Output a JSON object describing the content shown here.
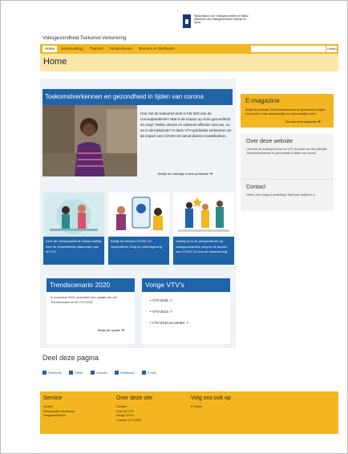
{
  "header": {
    "logo_text": "Rijksinstituut voor Volksgezondheid en Milieu Ministerie van Volksgezondheid, Welzijn en Sport",
    "site_name": "Volksgezondheid Toekomst Verkenning"
  },
  "nav": {
    "items": [
      "Home",
      "Samenvatting",
      "Thema's",
      "Perspectieven",
      "Bronnen en Methoden"
    ],
    "search_placeholder": "",
    "search_button": "Zoeken"
  },
  "page": {
    "title": "Home"
  },
  "hero": {
    "heading": "Toekomstverkennen en gezondheid in tijden van corona",
    "text": "Hoe ziet de toekomst eruit in het licht van de coronapandemie? Wat is de impact op onze gezondheid en zorg? Welke directe en indirecte effecten zien we, nu en in de toekomst? In deze VTV-publicatie verkennen we de impact van COVID-19 vanuit diverse invalshoeken.",
    "link": "Bekijk de volledige online publicatie"
  },
  "cards": [
    {
      "caption": "Lees de overkoepelende Samenvatting over de verschillende uitkomsten van de VTV"
    },
    {
      "caption": "Bekijk de thema's COVID-19, Gezondheid, Zorg en Leefomgeving"
    },
    {
      "caption": "Verdiep je in de perspectieven op volksgezondheid, zorg en de impact van COVID-19 voor de samenleving"
    }
  ],
  "trend": {
    "heading": "Trendscenario 2020",
    "text": "In november 2020 verscheen een update van het Trendscenario uit de VTV-2018.",
    "link": "Bekijk de update"
  },
  "vorige": {
    "heading": "Vorige VTV's",
    "items": [
      "VTV-2018",
      "VTV-2014",
      "VTV-2010 en eerder"
    ]
  },
  "emagazine": {
    "title": "E-magazine",
    "text": "Bekijk de publicatie 'Toekomstverkennen en gezondheid in tijden van corona' in een aantrekkelijke en overzichtelijke vorm.",
    "link": "Ga naar het e-magazine"
  },
  "about": {
    "title": "Over deze website",
    "text": "Lees hier de achtergrond van de VTV, de opzet van de publicatie Toekomstverkennen en gezondheid in tijden van corona."
  },
  "contact": {
    "title": "Contact",
    "text": "Heeft u een vraag of opmerking? Mail naar vtv@rivm.nl"
  },
  "share": {
    "title": "Deel deze pagina",
    "items": [
      "Facebook",
      "Twitter",
      "LinkedIn",
      "WhatsApp",
      "E-mail"
    ]
  },
  "footer": {
    "service": {
      "title": "Service",
      "links": [
        "Archief",
        "Responsible disclosure",
        "Toegankelijkheid"
      ]
    },
    "about": {
      "title": "Over deze site",
      "links": [
        "Contact",
        "Over de VTV",
        "Vorige VTV's",
        "Colofon VTV-2018"
      ]
    },
    "follow": {
      "title": "Volg ons ook op",
      "links": [
        "Twitter"
      ]
    }
  },
  "colors": {
    "accent_yellow": "#f3b520",
    "brand_blue": "#1f63a8",
    "title_bg": "#fbe7a9"
  }
}
